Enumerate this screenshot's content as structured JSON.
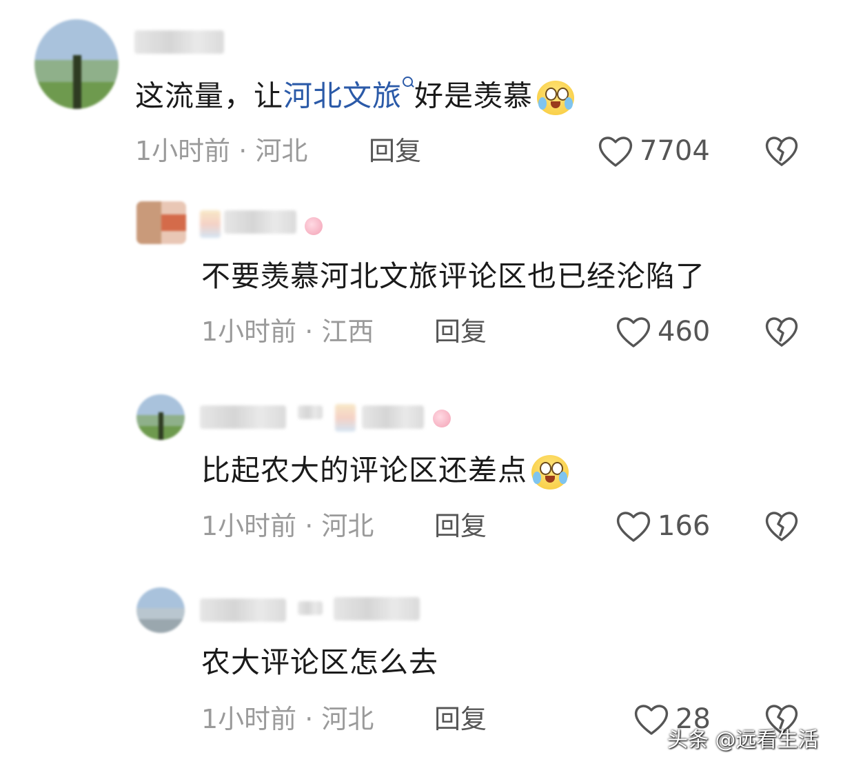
{
  "comments": [
    {
      "text_before": "这流量，让",
      "link": "河北文旅",
      "text_after": "好是羡慕",
      "meta": "1小时前 · 河北",
      "reply_label": "回复",
      "like_count": "7704"
    },
    {
      "text": "不要羡慕河北文旅评论区也已经沦陷了",
      "meta": "1小时前 · 江西",
      "reply_label": "回复",
      "like_count": "460"
    },
    {
      "text": "比起农大的评论区还差点",
      "meta": "1小时前 · 河北",
      "reply_label": "回复",
      "like_count": "166"
    },
    {
      "text": "农大评论区怎么去",
      "meta": "1小时前 · 河北",
      "reply_label": "回复",
      "like_count": "28"
    }
  ],
  "watermark": "头条 @远看生活",
  "colors": {
    "link": "#2b5aa8",
    "meta": "#9a9a9a",
    "text": "#1a1a1a"
  },
  "icons": [
    "heart-outline-icon",
    "broken-heart-icon",
    "search-icon",
    "crying-emoji"
  ]
}
